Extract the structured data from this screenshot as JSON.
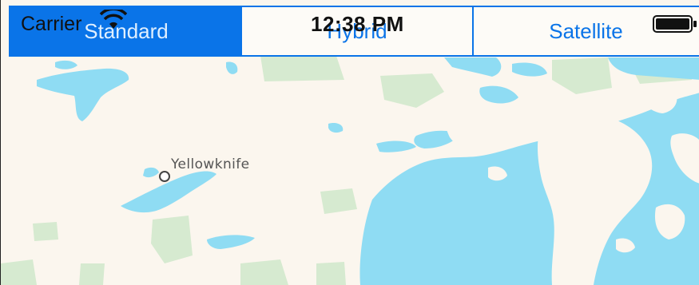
{
  "status_bar": {
    "carrier": "Carrier",
    "time": "12:38 PM",
    "wifi_icon": "wifi-icon",
    "battery_icon": "battery-icon",
    "battery_level": 1.0
  },
  "map_type_control": {
    "segments": [
      {
        "label": "Standard",
        "selected": true
      },
      {
        "label": "Hybrid",
        "selected": false
      },
      {
        "label": "Satellite",
        "selected": false
      }
    ]
  },
  "map": {
    "places": [
      {
        "name": "Yellowknife"
      }
    ],
    "colors": {
      "land": "#fbf6ee",
      "water": "#8fdcf3",
      "park": "#d6ead0"
    }
  }
}
